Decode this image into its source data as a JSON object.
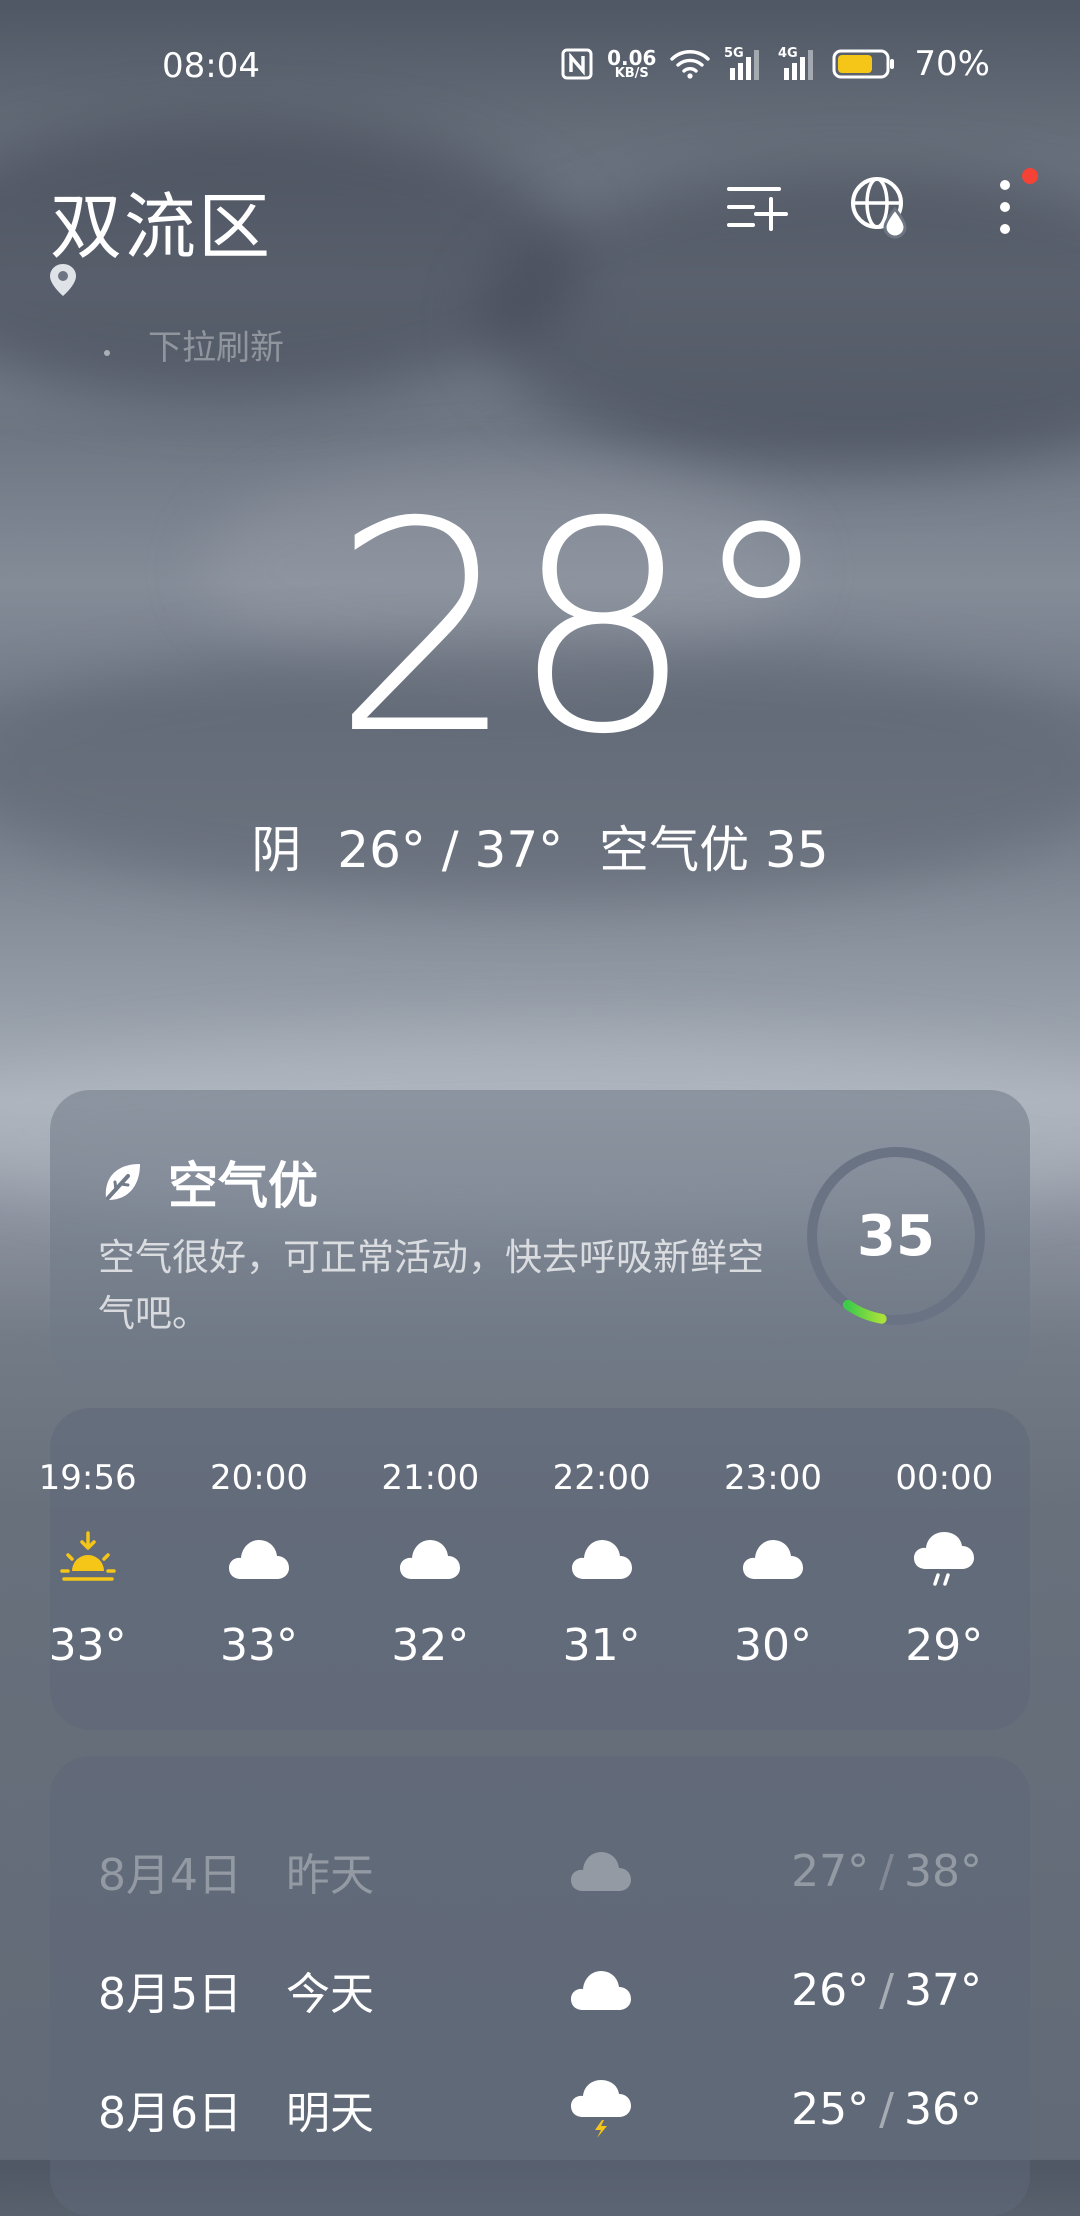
{
  "status_bar": {
    "time": "08:04",
    "net_speed": "0.06",
    "net_unit": "KB/S",
    "sig1_label": "5G",
    "sig2_label": "4G",
    "battery": "70%"
  },
  "header": {
    "location": "双流区",
    "pull_hint": "下拉刷新"
  },
  "current": {
    "temperature": "28°",
    "condition": "阴",
    "range": "26° / 37°",
    "air": "空气优 35"
  },
  "aqi": {
    "title": "空气优",
    "description": "空气很好，可正常活动，快去呼吸新鲜空气吧。",
    "value": "35",
    "level": 0.07,
    "colors": {
      "start": "#3ecb4a",
      "end": "#a8e23a",
      "track": "#6a7384"
    }
  },
  "hourly": [
    {
      "time": "19:56",
      "icon": "sunset-icon",
      "temp": "33°"
    },
    {
      "time": "20:00",
      "icon": "cloud-icon",
      "temp": "33°"
    },
    {
      "time": "21:00",
      "icon": "cloud-icon",
      "temp": "32°"
    },
    {
      "time": "22:00",
      "icon": "cloud-icon",
      "temp": "31°"
    },
    {
      "time": "23:00",
      "icon": "cloud-icon",
      "temp": "30°"
    },
    {
      "time": "00:00",
      "icon": "rain-cloud-icon",
      "temp": "29°"
    }
  ],
  "daily": [
    {
      "date": "8月4日",
      "day": "昨天",
      "icon": "cloud-icon",
      "low": "27°",
      "high": "38°"
    },
    {
      "date": "8月5日",
      "day": "今天",
      "icon": "cloud-icon",
      "low": "26°",
      "high": "37°"
    },
    {
      "date": "8月6日",
      "day": "明天",
      "icon": "thunder-cloud-icon",
      "low": "25°",
      "high": "36°"
    }
  ]
}
